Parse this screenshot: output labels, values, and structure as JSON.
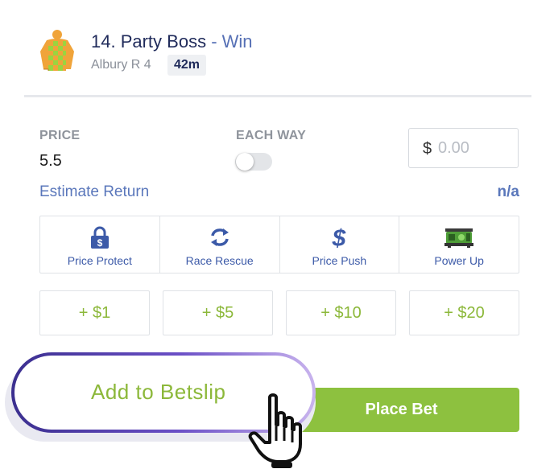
{
  "runner": {
    "title": "14. Party Boss",
    "separator": " - ",
    "bet_type": "Win",
    "race": "Albury R 4",
    "time_to_jump": "42m",
    "silks_icon": "jockey-silks-icon",
    "silks_colors": {
      "primary": "#f0a43a",
      "secondary": "#9bd43f"
    }
  },
  "bet_inputs": {
    "price_label": "PRICE",
    "price_value": "5.5",
    "each_way_label": "EACH WAY",
    "each_way_on": false,
    "currency_symbol": "$",
    "stake_placeholder": "0.00",
    "estimate_label": "Estimate Return",
    "estimate_value": "n/a"
  },
  "features": [
    {
      "label": "Price Protect",
      "icon": "padlock-dollar-icon"
    },
    {
      "label": "Race Rescue",
      "icon": "refresh-arrows-icon"
    },
    {
      "label": "Price Push",
      "icon": "dollar-sign-icon"
    },
    {
      "label": "Power Up",
      "icon": "power-up-machine-icon"
    }
  ],
  "quick_stakes": [
    "+ $1",
    "+ $5",
    "+ $10",
    "+ $20"
  ],
  "actions": {
    "add_to_betslip": "Add to Betslip",
    "place_bet": "Place Bet"
  },
  "colors": {
    "brand_green": "#8dc13f",
    "brand_blue": "#3c5aa8",
    "navy_text": "#1f2a5a"
  }
}
